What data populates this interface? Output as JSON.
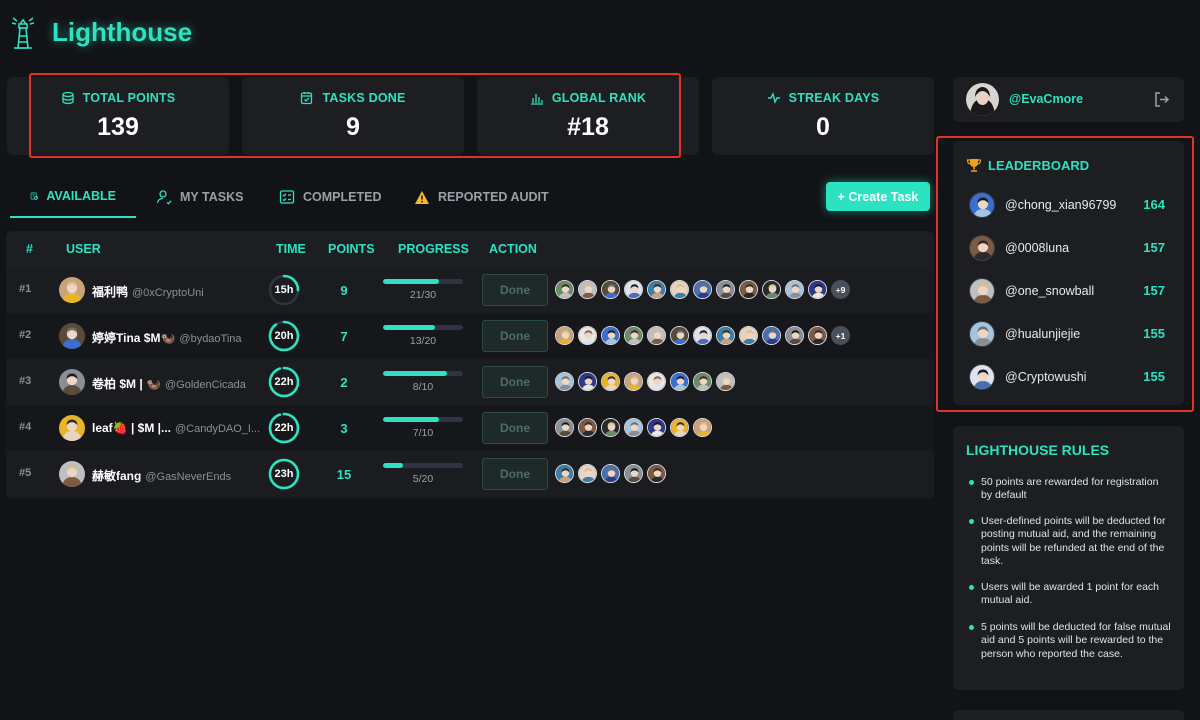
{
  "app": {
    "title": "Lighthouse"
  },
  "stats": [
    {
      "label": "TOTAL POINTS",
      "value": "139",
      "icon": "database-icon"
    },
    {
      "label": "TASKS DONE",
      "value": "9",
      "icon": "calendar-check-icon"
    },
    {
      "label": "GLOBAL RANK",
      "value": "#18",
      "icon": "bar-chart-icon"
    },
    {
      "label": "STREAK DAYS",
      "value": "0",
      "icon": "activity-icon"
    }
  ],
  "tabs": [
    {
      "label": "AVAILABLE",
      "icon": "task-list-icon",
      "active": true
    },
    {
      "label": "MY TASKS",
      "icon": "user-icon",
      "active": false
    },
    {
      "label": "COMPLETED",
      "icon": "checklist-icon",
      "active": false
    },
    {
      "label": "REPORTED AUDIT",
      "icon": "warning-icon",
      "active": false
    }
  ],
  "create_task_label": "+ Create Task",
  "table": {
    "headers": [
      "#",
      "USER",
      "TIME",
      "POINTS",
      "PROGRESS",
      "ACTION"
    ],
    "rows": [
      {
        "rank": "#1",
        "name": "福利鸭",
        "handle": "@0xCryptoUni",
        "time": "15h",
        "time_fraction": 0.25,
        "points": "9",
        "progress": "21/30",
        "progress_fraction": 0.7,
        "action": "Done",
        "participants": 12,
        "extra": "+9"
      },
      {
        "rank": "#2",
        "name": "婷婷Tina $M🦦",
        "handle": "@bydaoTina",
        "time": "20h",
        "time_fraction": 0.9,
        "points": "7",
        "progress": "13/20",
        "progress_fraction": 0.65,
        "action": "Done",
        "participants": 12,
        "extra": "+1"
      },
      {
        "rank": "#3",
        "name": "卷柏 $M | 🦦",
        "handle": "@GoldenCicada",
        "time": "22h",
        "time_fraction": 0.95,
        "points": "2",
        "progress": "8/10",
        "progress_fraction": 0.8,
        "action": "Done",
        "participants": 8,
        "extra": ""
      },
      {
        "rank": "#4",
        "name": "leaf🍓 | $M |...",
        "handle": "@CandyDAO_I...",
        "time": "22h",
        "time_fraction": 0.95,
        "points": "3",
        "progress": "7/10",
        "progress_fraction": 0.7,
        "action": "Done",
        "participants": 7,
        "extra": ""
      },
      {
        "rank": "#5",
        "name": "赫敏fang",
        "handle": "@GasNeverEnds",
        "time": "23h",
        "time_fraction": 0.98,
        "points": "15",
        "progress": "5/20",
        "progress_fraction": 0.25,
        "action": "Done",
        "participants": 5,
        "extra": ""
      }
    ]
  },
  "profile": {
    "username": "@EvaCmore"
  },
  "leaderboard": {
    "title": "LEADERBOARD",
    "entries": [
      {
        "name": "@chong_xian96799",
        "score": "164"
      },
      {
        "name": "@0008luna",
        "score": "157"
      },
      {
        "name": "@one_snowball",
        "score": "157"
      },
      {
        "name": "@hualunjiejie",
        "score": "155"
      },
      {
        "name": "@Cryptowushi",
        "score": "155"
      }
    ]
  },
  "rules": {
    "title": "LIGHTHOUSE RULES",
    "items": [
      "50 points are rewarded for registration by default",
      "User-defined points will be deducted for posting mutual aid, and the remaining points will be refunded at the end of the task.",
      "Users will be awarded 1 point for each mutual aid.",
      "5 points will be deducted for false mutual aid and 5 points will be rewarded to the person who reported the case."
    ]
  },
  "colors": {
    "accent": "#2de2c0",
    "background": "#121316",
    "card": "#1c1e22",
    "highlight": "#e0342a"
  }
}
